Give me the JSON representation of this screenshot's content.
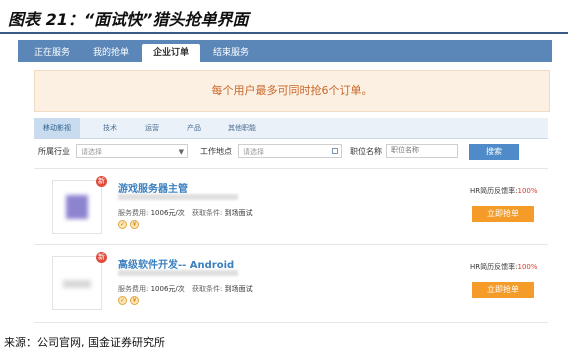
{
  "figure": {
    "title": "图表 21：“面试快”猎头抢单界面",
    "source": "来源：公司官网, 国金证券研究所"
  },
  "topnav": {
    "tabs": [
      {
        "label": "正在服务",
        "active": false
      },
      {
        "label": "我的抢单",
        "active": false
      },
      {
        "label": "企业订单",
        "active": true
      },
      {
        "label": "结束服务",
        "active": false
      }
    ]
  },
  "notice": "每个用户最多可同时抢6个订单。",
  "category_tabs": [
    {
      "label": "移动影视",
      "active": true
    },
    {
      "label": "技术",
      "active": false
    },
    {
      "label": "运营",
      "active": false
    },
    {
      "label": "产品",
      "active": false
    },
    {
      "label": "其他职能",
      "active": false
    }
  ],
  "filters": {
    "industry_label": "所属行业",
    "industry_placeholder": "请选择",
    "location_label": "工作地点",
    "location_placeholder": "请选择",
    "position_label": "职位名称",
    "position_placeholder": "职位名称",
    "search_button": "搜索"
  },
  "jobs": [
    {
      "badge": "新",
      "title": "游戏服务器主管",
      "fee_label": "服务费用:",
      "fee_value": "1006元/次",
      "condition_label": "获取条件:",
      "condition_value": "到场面试",
      "rate_label": "HR简历反馈率:",
      "rate_value": "100%",
      "grab_button": "立即抢单"
    },
    {
      "badge": "新",
      "title": "高级软件开发-- Android",
      "fee_label": "服务费用:",
      "fee_value": "1006元/次",
      "condition_label": "获取条件:",
      "condition_value": "到场面试",
      "rate_label": "HR简历反馈率:",
      "rate_value": "100%",
      "grab_button": "立即抢单"
    }
  ]
}
